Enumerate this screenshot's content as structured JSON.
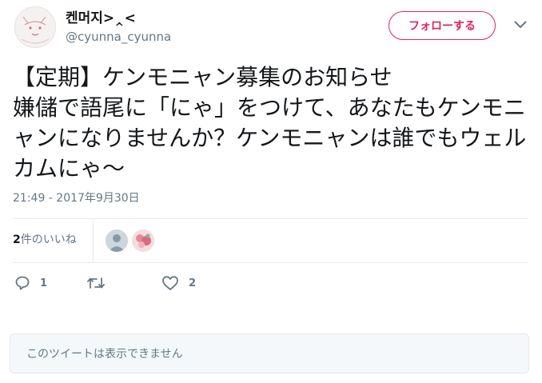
{
  "header": {
    "display_name": "켄머지>‸<",
    "screen_name": "@cyunna_cyunna",
    "follow_label": "フォローする",
    "caret_icon": "chevron-down-icon"
  },
  "tweet": {
    "text": "【定期】ケンモニャン募集のお知らせ\n嫌儲で語尾に「にゃ」をつけて、あなたもケンモニャンになりませんか？ケンモニャンは誰でもウェルカムにゃ〜",
    "timestamp": "21:49 - 2017年9月30日"
  },
  "likes": {
    "count": "2",
    "label": "件のいいね"
  },
  "actions": {
    "reply_count": "1",
    "retweet_count": "",
    "like_count": "2"
  },
  "quoted": {
    "text": "このツイートは表示できません"
  },
  "colors": {
    "accent": "#e0245e",
    "muted": "#657786",
    "text": "#14171a",
    "border": "#e6ecf0",
    "quoted_bg": "#f5f8fa"
  }
}
